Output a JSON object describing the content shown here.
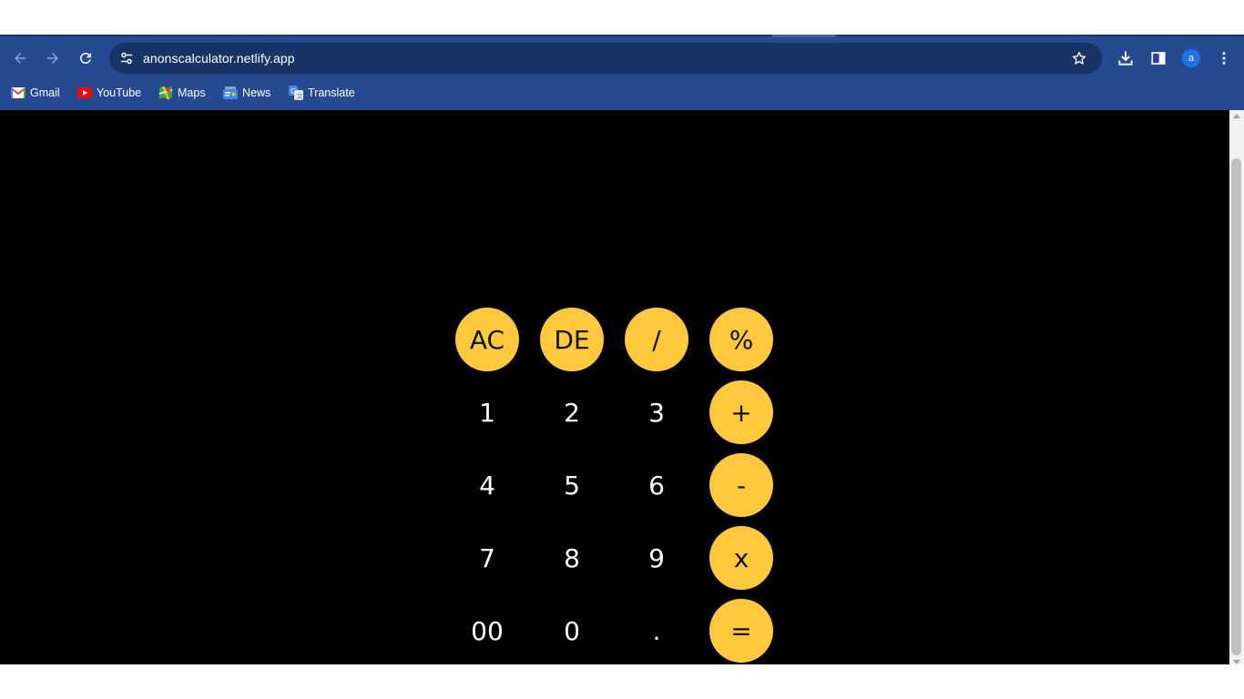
{
  "browser": {
    "url": "anonscalculator.netlify.app",
    "profile_initial": "a",
    "frame_color": "#264a8f",
    "omnibox_color": "#183466",
    "icons": {
      "back": "arrow-left-icon",
      "forward": "arrow-right-icon",
      "reload": "reload-icon",
      "site_settings": "tune-icon",
      "bookmark_star": "star-icon",
      "downloads": "download-icon",
      "side_panel": "side-panel-icon",
      "menu": "kebab-menu-icon"
    },
    "bookmarks": [
      {
        "label": "Gmail",
        "icon": "gmail-icon"
      },
      {
        "label": "YouTube",
        "icon": "youtube-icon"
      },
      {
        "label": "Maps",
        "icon": "maps-icon"
      },
      {
        "label": "News",
        "icon": "news-icon"
      },
      {
        "label": "Translate",
        "icon": "translate-icon"
      }
    ]
  },
  "calculator": {
    "accent_color": "#ffc83d",
    "background": "#000000",
    "display_value": "",
    "keys": [
      [
        "AC",
        "DE",
        "/",
        "%"
      ],
      [
        "1",
        "2",
        "3",
        "+"
      ],
      [
        "4",
        "5",
        "6",
        "-"
      ],
      [
        "7",
        "8",
        "9",
        "x"
      ],
      [
        "00",
        "0",
        ".",
        "="
      ]
    ]
  }
}
